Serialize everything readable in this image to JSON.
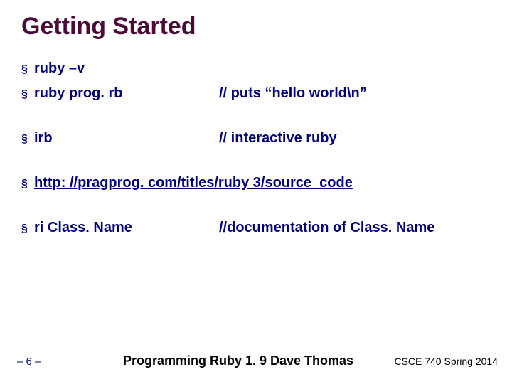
{
  "title": "Getting Started",
  "bullets": {
    "b1_left": "ruby –v",
    "b2_left": "ruby prog. rb",
    "b2_right": "// puts “hello world\\n”",
    "b3_left": "irb",
    "b3_right": "// interactive ruby",
    "b4_left": "http: //pragprog. com/titles/ruby 3/source_code",
    "b5_left": "ri Class. Name",
    "b5_right": "//documentation of Class. Name"
  },
  "bullet_mark": "§",
  "footer": {
    "page": "– 6 –",
    "center": "Programming Ruby 1. 9 Dave Thomas",
    "right": "CSCE 740 Spring 2014"
  }
}
